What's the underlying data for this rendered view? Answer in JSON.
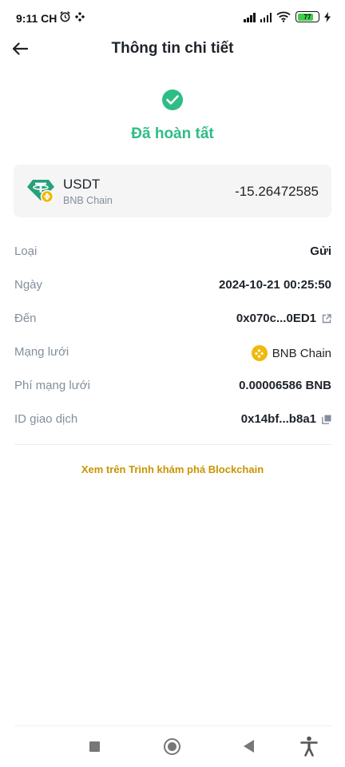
{
  "status_bar": {
    "time": "9:11 CH",
    "battery": "77"
  },
  "header": {
    "title": "Thông tin chi tiết"
  },
  "transaction_status": {
    "text": "Đã hoàn tất",
    "color": "#2ebd85"
  },
  "asset": {
    "name": "USDT",
    "chain": "BNB Chain",
    "amount": "-15.26472585",
    "icon": "usdt-bnb-icon"
  },
  "details": {
    "type_label": "Loại",
    "type_value": "Gửi",
    "date_label": "Ngày",
    "date_value": "2024-10-21 00:25:50",
    "to_label": "Đến",
    "to_value": "0x070c...0ED1",
    "network_label": "Mạng lưới",
    "network_value": "BNB Chain",
    "fee_label": "Phí mạng lưới",
    "fee_value": "0.00006586 BNB",
    "txid_label": "ID giao dịch",
    "txid_value": "0x14bf...b8a1"
  },
  "explorer_link": "Xem trên Trình khám phá Blockchain",
  "colors": {
    "accent": "#c99400",
    "success": "#2ebd85",
    "bnb": "#f0b90b",
    "tether": "#26a17b"
  }
}
